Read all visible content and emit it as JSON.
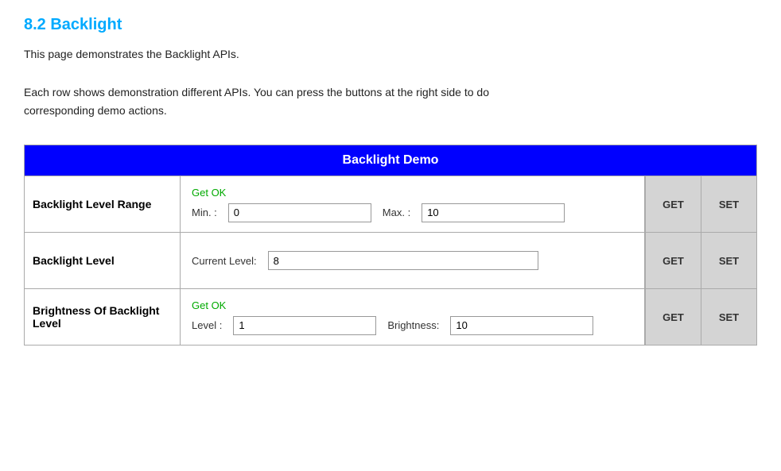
{
  "page": {
    "title": "8.2 Backlight",
    "description_line1": "This page demonstrates the Backlight APIs.",
    "description_line2": "Each row shows demonstration different APIs. You can press the buttons at the right side to do",
    "description_line3": "corresponding demo actions."
  },
  "demo": {
    "header": "Backlight Demo",
    "rows": [
      {
        "id": "backlight-level-range",
        "label": "Backlight Level Range",
        "status": "Get OK",
        "fields": [
          {
            "label": "Min. :",
            "value": "0",
            "type": "short"
          },
          {
            "label": "Max. :",
            "value": "10",
            "type": "short"
          }
        ],
        "get_label": "GET",
        "set_label": "SET"
      },
      {
        "id": "backlight-level",
        "label": "Backlight Level",
        "status": "",
        "fields": [
          {
            "label": "Current Level:",
            "value": "8",
            "type": "long"
          }
        ],
        "get_label": "GET",
        "set_label": "SET"
      },
      {
        "id": "brightness-of-backlight-level",
        "label": "Brightness Of Backlight Level",
        "status": "Get OK",
        "fields": [
          {
            "label": "Level :",
            "value": "1",
            "type": "short"
          },
          {
            "label": "Brightness:",
            "value": "10",
            "type": "short"
          }
        ],
        "get_label": "GET",
        "set_label": "SET"
      }
    ]
  }
}
